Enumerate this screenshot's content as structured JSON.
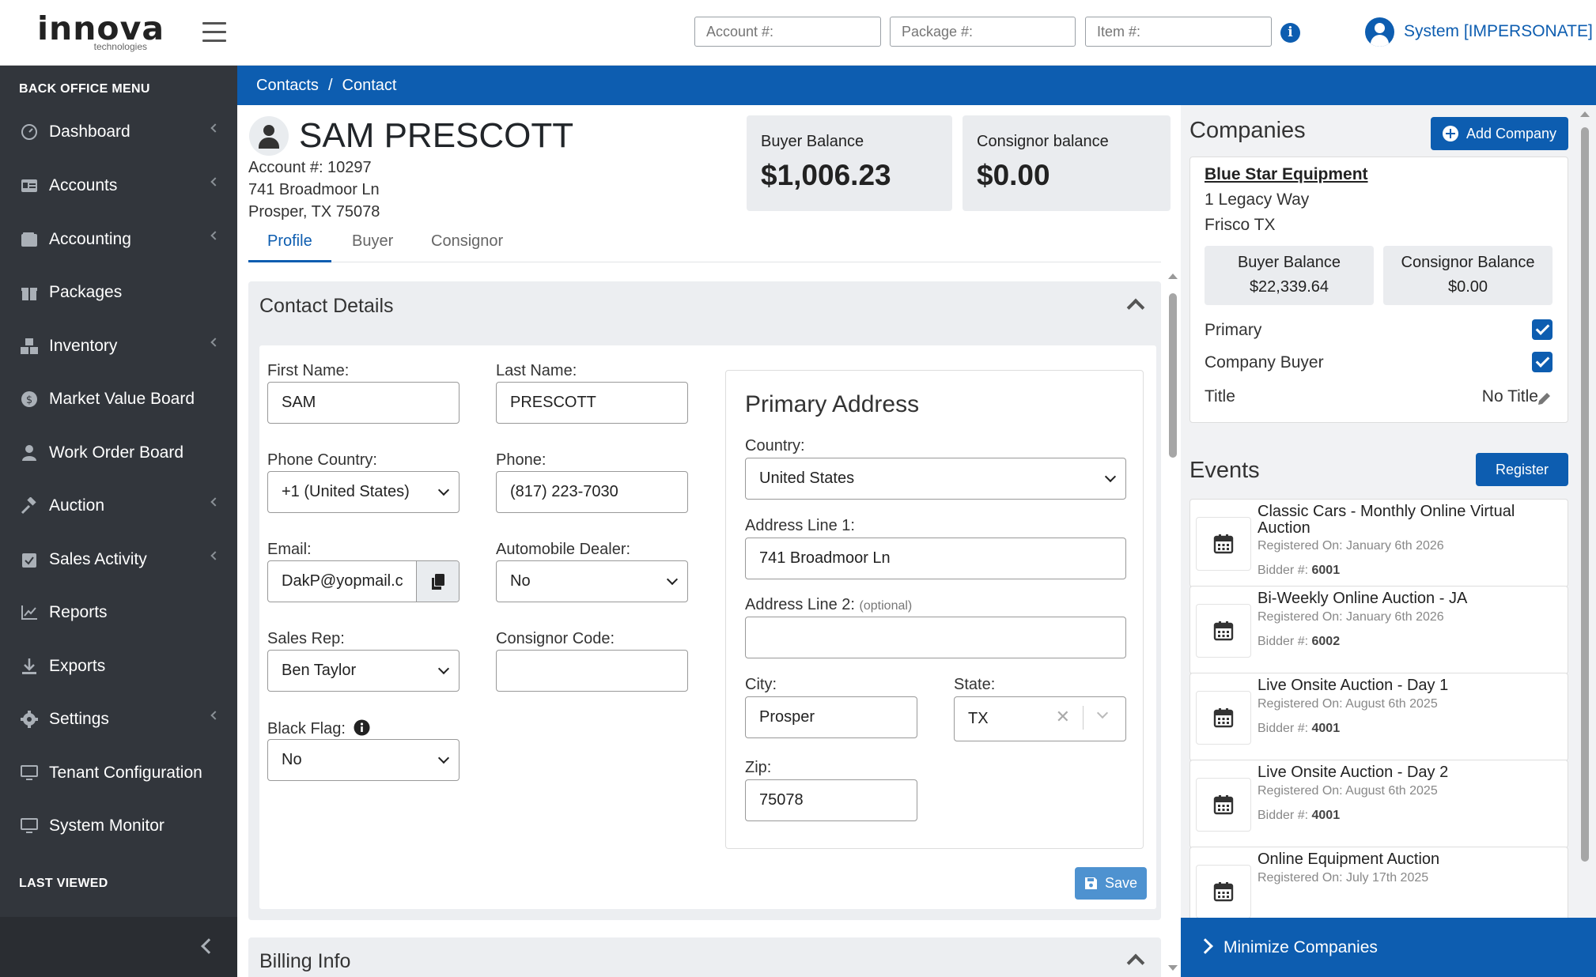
{
  "header": {
    "logo_text": "innova",
    "logo_sub": "technologies",
    "account_placeholder": "Account #:",
    "package_placeholder": "Package #:",
    "item_placeholder": "Item #:",
    "user": "System [IMPERSONATE]"
  },
  "sidebar": {
    "title": "BACK OFFICE MENU",
    "items": [
      {
        "label": "Dashboard",
        "icon": "gauge-icon"
      },
      {
        "label": "Accounts",
        "icon": "id-card-icon"
      },
      {
        "label": "Accounting",
        "icon": "wallet-icon"
      },
      {
        "label": "Packages",
        "icon": "gift-icon"
      },
      {
        "label": "Inventory",
        "icon": "boxes-icon"
      },
      {
        "label": "Market Value Board",
        "icon": "coin-icon"
      },
      {
        "label": "Work Order Board",
        "icon": "worker-icon"
      },
      {
        "label": "Auction",
        "icon": "gavel-icon"
      },
      {
        "label": "Sales Activity",
        "icon": "clipboard-check-icon"
      },
      {
        "label": "Reports",
        "icon": "chart-line-icon"
      },
      {
        "label": "Exports",
        "icon": "download-icon"
      },
      {
        "label": "Settings",
        "icon": "gear-icon"
      },
      {
        "label": "Tenant Configuration",
        "icon": "monitor-icon"
      },
      {
        "label": "System Monitor",
        "icon": "monitor-icon"
      }
    ],
    "last_viewed": "LAST VIEWED"
  },
  "breadcrumb": {
    "parent": "Contacts",
    "sep": "/",
    "current": "Contact"
  },
  "contact": {
    "name": "SAM PRESCOTT",
    "account": "Account #: 10297",
    "address1": "741 Broadmoor Ln",
    "address2": "Prosper, TX 75078",
    "buyer_balance_label": "Buyer Balance",
    "buyer_balance": "$1,006.23",
    "consignor_balance_label": "Consignor balance",
    "consignor_balance": "$0.00"
  },
  "tabs": [
    "Profile",
    "Buyer",
    "Consignor"
  ],
  "details": {
    "title": "Contact Details",
    "first_name_label": "First Name:",
    "first_name": "SAM",
    "last_name_label": "Last Name:",
    "last_name": "PRESCOTT",
    "phone_country_label": "Phone Country:",
    "phone_country": "+1 (United States)",
    "phone_label": "Phone:",
    "phone": "(817) 223-7030",
    "email_label": "Email:",
    "email": "DakP@yopmail.c",
    "auto_dealer_label": "Automobile Dealer:",
    "auto_dealer": "No",
    "sales_rep_label": "Sales Rep:",
    "sales_rep": "Ben Taylor",
    "consignor_code_label": "Consignor Code:",
    "consignor_code": "",
    "black_flag_label": "Black Flag:",
    "black_flag": "No",
    "save_label": "Save"
  },
  "address": {
    "title": "Primary Address",
    "country_label": "Country:",
    "country": "United States",
    "line1_label": "Address Line 1:",
    "line1": "741 Broadmoor Ln",
    "line2_label": "Address Line 2:",
    "line2_optional": "(optional)",
    "line2": "",
    "city_label": "City:",
    "city": "Prosper",
    "state_label": "State:",
    "state": "TX",
    "zip_label": "Zip:",
    "zip": "75078"
  },
  "billing": {
    "title": "Billing Info"
  },
  "companies": {
    "title": "Companies",
    "add_label": "Add Company",
    "name": "Blue Star Equipment",
    "line1": "1 Legacy Way",
    "line2": "Frisco TX",
    "buyer_balance_label": "Buyer Balance",
    "buyer_balance": "$22,339.64",
    "consignor_balance_label": "Consignor Balance",
    "consignor_balance": "$0.00",
    "primary_label": "Primary",
    "primary": true,
    "company_buyer_label": "Company Buyer",
    "company_buyer": true,
    "title_label": "Title",
    "title_value": "No Title"
  },
  "events": {
    "title": "Events",
    "register_label": "Register",
    "bidder_label": "Bidder #:",
    "items": [
      {
        "name": "Classic Cars - Monthly Online Virtual Auction",
        "registered": "Registered On: January 6th 2026",
        "bidder": "6001"
      },
      {
        "name": "Bi-Weekly Online Auction - JA",
        "registered": "Registered On: January 6th 2026",
        "bidder": "6002"
      },
      {
        "name": "Live Onsite Auction - Day 1",
        "registered": "Registered On: August 6th 2025",
        "bidder": "4001"
      },
      {
        "name": "Live Onsite Auction - Day 2",
        "registered": "Registered On: August 6th 2025",
        "bidder": "4001"
      },
      {
        "name": "Online Equipment Auction",
        "registered": "Registered On: July 17th 2025",
        "bidder": ""
      }
    ]
  },
  "minimize_label": "Minimize Companies",
  "colors": {
    "primary": "#0d5db0",
    "sidebar": "#32363c",
    "save": "#4e92d0"
  }
}
